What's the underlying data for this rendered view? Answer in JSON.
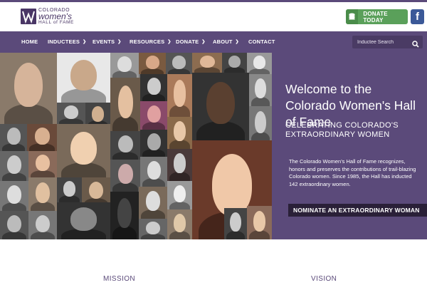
{
  "logo": {
    "line1": "COLORADO",
    "line2": "women's",
    "line3": "HALL of FAME"
  },
  "header": {
    "donate_label": "DONATE TODAY",
    "facebook_glyph": "f"
  },
  "nav": {
    "items": [
      {
        "label": "HOME",
        "dropdown": false
      },
      {
        "label": "INDUCTEES",
        "dropdown": true
      },
      {
        "label": "EVENTS",
        "dropdown": true
      },
      {
        "label": "RESOURCES",
        "dropdown": true
      },
      {
        "label": "DONATE",
        "dropdown": true
      },
      {
        "label": "ABOUT",
        "dropdown": true
      },
      {
        "label": "CONTACT",
        "dropdown": false
      }
    ],
    "search_placeholder": "Inductee Search"
  },
  "hero": {
    "title": "Welcome to the Colorado Women's Hall of Fame",
    "subtitle": "CELEBRATING COLORADO'S EXTRAORDINARY WOMEN",
    "body": "The Colorado Women's Hall of Fame recognizes, honors and preserves the contributions of trail-blazing Colorado women. Since 1985, the Hall has inducted 142 extraordinary women.",
    "cta_label": "NOMINATE AN EXTRAORDINARY WOMAN"
  },
  "sections": {
    "mission": "MISSION",
    "vision": "VISION"
  },
  "colors": {
    "brand_purple": "#5b4a7a",
    "donate_green": "#5aa05a",
    "facebook_blue": "#3b5998",
    "cta_dark": "#2a2038"
  }
}
